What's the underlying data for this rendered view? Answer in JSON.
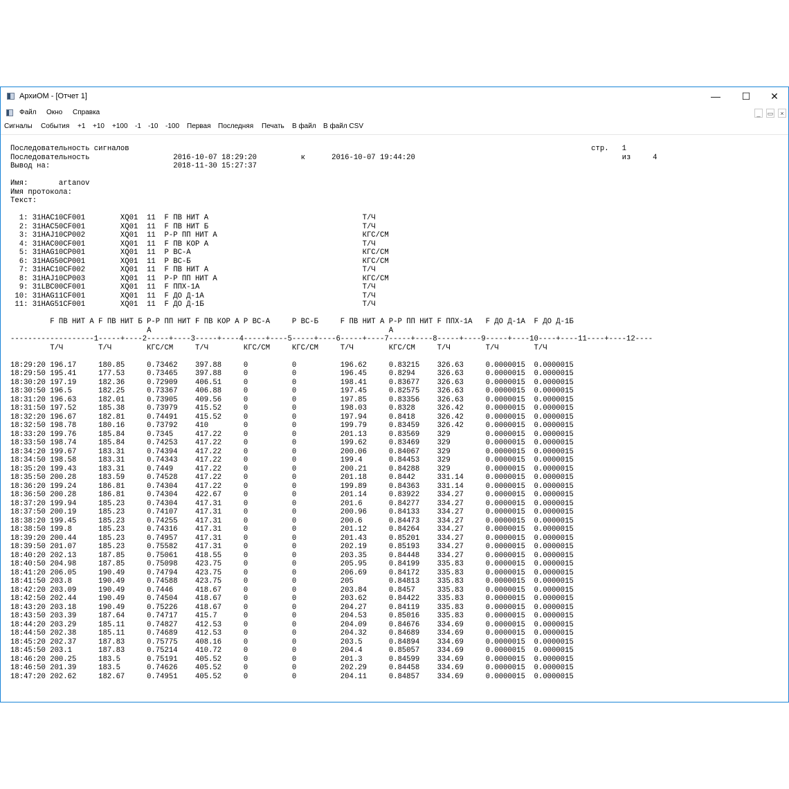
{
  "window": {
    "title": "АрхиОМ - [Отчет 1]",
    "controls": {
      "minimize": "—",
      "maximize": "☐",
      "close": "✕"
    },
    "icon": "app-window-icon"
  },
  "menu": {
    "items": [
      "Файл",
      "Окно",
      "Справка"
    ],
    "mdi_controls": {
      "minimize": "_",
      "restore": "▭",
      "close": "×"
    }
  },
  "toolbar": {
    "items": [
      "Сигналы",
      "События",
      "+1",
      "+10",
      "+100",
      "-1",
      "-10",
      "-100",
      "Первая",
      "Последняя",
      "Печать",
      "В файл",
      "В файл CSV"
    ]
  },
  "report": {
    "header": {
      "title": "Последовательность сигналов",
      "sequence_label": "Последовательность",
      "from": "2016-10-07 18:29:20",
      "to_word": "к",
      "to": "2016-10-07 19:44:20",
      "output_label": "Вывод на:",
      "output_time": "2018-11-30 15:27:37",
      "page_label": "стр.",
      "page": "1",
      "of_label": "из",
      "pages": "4",
      "name_label": "Имя:",
      "name": "artanov",
      "protocol_label": "Имя протокола:",
      "text_label": "Текст:"
    },
    "signals": [
      {
        "n": "1:",
        "code": "31HAC10CF001",
        "type": "XQ01",
        "num": "11",
        "desc": "F ПВ НИТ А",
        "unit": "Т/Ч"
      },
      {
        "n": "2:",
        "code": "31HAC50CF001",
        "type": "XQ01",
        "num": "11",
        "desc": "F ПВ НИТ Б",
        "unit": "Т/Ч"
      },
      {
        "n": "3:",
        "code": "31HAJ10CP002",
        "type": "XQ01",
        "num": "11",
        "desc": "Р-Р ПП НИТ А",
        "unit": "КГС/СМ"
      },
      {
        "n": "4:",
        "code": "31HAC00CF001",
        "type": "XQ01",
        "num": "11",
        "desc": "F ПВ КОР А",
        "unit": "Т/Ч"
      },
      {
        "n": "5:",
        "code": "31HAG10CP001",
        "type": "XQ01",
        "num": "11",
        "desc": "P ВС-А",
        "unit": "КГС/СМ"
      },
      {
        "n": "6:",
        "code": "31HAG50CP001",
        "type": "XQ01",
        "num": "11",
        "desc": "P ВС-Б",
        "unit": "КГС/СМ"
      },
      {
        "n": "7:",
        "code": "31HAC10CF002",
        "type": "XQ01",
        "num": "11",
        "desc": "F ПВ НИТ А",
        "unit": "Т/Ч"
      },
      {
        "n": "8:",
        "code": "31HAJ10CP003",
        "type": "XQ01",
        "num": "11",
        "desc": "Р-Р ПП НИТ А",
        "unit": "КГС/СМ"
      },
      {
        "n": "9:",
        "code": "31LBC00CF001",
        "type": "XQ01",
        "num": "11",
        "desc": "F ППХ-1А",
        "unit": "Т/Ч"
      },
      {
        "n": "10:",
        "code": "31HAG11CF001",
        "type": "XQ01",
        "num": "11",
        "desc": "F ДО Д-1А",
        "unit": "Т/Ч"
      },
      {
        "n": "11:",
        "code": "31HAG51CF001",
        "type": "XQ01",
        "num": "11",
        "desc": "F ДО Д-1Б",
        "unit": "Т/Ч"
      }
    ],
    "column_headers": [
      "F ПВ НИТ А",
      "F ПВ НИТ Б",
      "Р-Р ПП НИТ\nА",
      "F ПВ КОР А",
      "P ВС-А",
      "P ВС-Б",
      "F ПВ НИТ А",
      "Р-Р ПП НИТ\nА",
      "F ППХ-1А",
      "F ДО Д-1А",
      "F ДО Д-1Б"
    ],
    "column_numbers": [
      "1",
      "2",
      "3",
      "4",
      "5",
      "6",
      "7",
      "8",
      "9",
      "10",
      "11",
      "12"
    ],
    "column_units": [
      "Т/Ч",
      "Т/Ч",
      "КГС/СМ",
      "Т/Ч",
      "КГС/СМ",
      "КГС/СМ",
      "Т/Ч",
      "КГС/СМ",
      "Т/Ч",
      "Т/Ч",
      "Т/Ч"
    ],
    "rows": [
      [
        "18:29:20",
        "196.17",
        "180.85",
        "0.73462",
        "397.88",
        "0",
        "0",
        "196.62",
        "0.83215",
        "326.63",
        "0.0000015",
        "0.0000015"
      ],
      [
        "18:29:50",
        "195.41",
        "177.53",
        "0.73465",
        "397.88",
        "0",
        "0",
        "196.45",
        "0.8294",
        "326.63",
        "0.0000015",
        "0.0000015"
      ],
      [
        "18:30:20",
        "197.19",
        "182.36",
        "0.72909",
        "406.51",
        "0",
        "0",
        "198.41",
        "0.83677",
        "326.63",
        "0.0000015",
        "0.0000015"
      ],
      [
        "18:30:50",
        "196.5",
        "182.25",
        "0.73367",
        "406.88",
        "0",
        "0",
        "197.45",
        "0.82575",
        "326.63",
        "0.0000015",
        "0.0000015"
      ],
      [
        "18:31:20",
        "196.63",
        "182.01",
        "0.73905",
        "409.56",
        "0",
        "0",
        "197.85",
        "0.83356",
        "326.63",
        "0.0000015",
        "0.0000015"
      ],
      [
        "18:31:50",
        "197.52",
        "185.38",
        "0.73979",
        "415.52",
        "0",
        "0",
        "198.03",
        "0.8328",
        "326.42",
        "0.0000015",
        "0.0000015"
      ],
      [
        "18:32:20",
        "196.67",
        "182.81",
        "0.74491",
        "415.52",
        "0",
        "0",
        "197.94",
        "0.8418",
        "326.42",
        "0.0000015",
        "0.0000015"
      ],
      [
        "18:32:50",
        "198.78",
        "180.16",
        "0.73792",
        "410",
        "0",
        "0",
        "199.79",
        "0.83459",
        "326.42",
        "0.0000015",
        "0.0000015"
      ],
      [
        "18:33:20",
        "199.76",
        "185.84",
        "0.7345",
        "417.22",
        "0",
        "0",
        "201.13",
        "0.83569",
        "329",
        "0.0000015",
        "0.0000015"
      ],
      [
        "18:33:50",
        "198.74",
        "185.84",
        "0.74253",
        "417.22",
        "0",
        "0",
        "199.62",
        "0.83469",
        "329",
        "0.0000015",
        "0.0000015"
      ],
      [
        "18:34:20",
        "199.67",
        "183.31",
        "0.74394",
        "417.22",
        "0",
        "0",
        "200.06",
        "0.84067",
        "329",
        "0.0000015",
        "0.0000015"
      ],
      [
        "18:34:50",
        "198.58",
        "183.31",
        "0.74343",
        "417.22",
        "0",
        "0",
        "199.4",
        "0.84453",
        "329",
        "0.0000015",
        "0.0000015"
      ],
      [
        "18:35:20",
        "199.43",
        "183.31",
        "0.7449",
        "417.22",
        "0",
        "0",
        "200.21",
        "0.84288",
        "329",
        "0.0000015",
        "0.0000015"
      ],
      [
        "18:35:50",
        "200.28",
        "183.59",
        "0.74528",
        "417.22",
        "0",
        "0",
        "201.18",
        "0.8442",
        "331.14",
        "0.0000015",
        "0.0000015"
      ],
      [
        "18:36:20",
        "199.24",
        "186.81",
        "0.74304",
        "417.22",
        "0",
        "0",
        "199.89",
        "0.84363",
        "331.14",
        "0.0000015",
        "0.0000015"
      ],
      [
        "18:36:50",
        "200.28",
        "186.81",
        "0.74304",
        "422.67",
        "0",
        "0",
        "201.14",
        "0.83922",
        "334.27",
        "0.0000015",
        "0.0000015"
      ],
      [
        "18:37:20",
        "199.94",
        "185.23",
        "0.74304",
        "417.31",
        "0",
        "0",
        "201.6",
        "0.84277",
        "334.27",
        "0.0000015",
        "0.0000015"
      ],
      [
        "18:37:50",
        "200.19",
        "185.23",
        "0.74107",
        "417.31",
        "0",
        "0",
        "200.96",
        "0.84133",
        "334.27",
        "0.0000015",
        "0.0000015"
      ],
      [
        "18:38:20",
        "199.45",
        "185.23",
        "0.74255",
        "417.31",
        "0",
        "0",
        "200.6",
        "0.84473",
        "334.27",
        "0.0000015",
        "0.0000015"
      ],
      [
        "18:38:50",
        "199.8",
        "185.23",
        "0.74316",
        "417.31",
        "0",
        "0",
        "201.12",
        "0.84264",
        "334.27",
        "0.0000015",
        "0.0000015"
      ],
      [
        "18:39:20",
        "200.44",
        "185.23",
        "0.74957",
        "417.31",
        "0",
        "0",
        "201.43",
        "0.85201",
        "334.27",
        "0.0000015",
        "0.0000015"
      ],
      [
        "18:39:50",
        "201.07",
        "185.23",
        "0.75582",
        "417.31",
        "0",
        "0",
        "202.19",
        "0.85193",
        "334.27",
        "0.0000015",
        "0.0000015"
      ],
      [
        "18:40:20",
        "202.13",
        "187.85",
        "0.75061",
        "418.55",
        "0",
        "0",
        "203.35",
        "0.84448",
        "334.27",
        "0.0000015",
        "0.0000015"
      ],
      [
        "18:40:50",
        "204.98",
        "187.85",
        "0.75098",
        "423.75",
        "0",
        "0",
        "205.95",
        "0.84199",
        "335.83",
        "0.0000015",
        "0.0000015"
      ],
      [
        "18:41:20",
        "206.05",
        "190.49",
        "0.74794",
        "423.75",
        "0",
        "0",
        "206.69",
        "0.84172",
        "335.83",
        "0.0000015",
        "0.0000015"
      ],
      [
        "18:41:50",
        "203.8",
        "190.49",
        "0.74588",
        "423.75",
        "0",
        "0",
        "205",
        "0.84813",
        "335.83",
        "0.0000015",
        "0.0000015"
      ],
      [
        "18:42:20",
        "203.09",
        "190.49",
        "0.7446",
        "418.67",
        "0",
        "0",
        "203.84",
        "0.8457",
        "335.83",
        "0.0000015",
        "0.0000015"
      ],
      [
        "18:42:50",
        "202.44",
        "190.49",
        "0.74504",
        "418.67",
        "0",
        "0",
        "203.62",
        "0.84422",
        "335.83",
        "0.0000015",
        "0.0000015"
      ],
      [
        "18:43:20",
        "203.18",
        "190.49",
        "0.75226",
        "418.67",
        "0",
        "0",
        "204.27",
        "0.84119",
        "335.83",
        "0.0000015",
        "0.0000015"
      ],
      [
        "18:43:50",
        "203.39",
        "187.64",
        "0.74717",
        "415.7",
        "0",
        "0",
        "204.53",
        "0.85016",
        "335.83",
        "0.0000015",
        "0.0000015"
      ],
      [
        "18:44:20",
        "203.29",
        "185.11",
        "0.74827",
        "412.53",
        "0",
        "0",
        "204.09",
        "0.84676",
        "334.69",
        "0.0000015",
        "0.0000015"
      ],
      [
        "18:44:50",
        "202.38",
        "185.11",
        "0.74689",
        "412.53",
        "0",
        "0",
        "204.32",
        "0.84689",
        "334.69",
        "0.0000015",
        "0.0000015"
      ],
      [
        "18:45:20",
        "202.37",
        "187.83",
        "0.75775",
        "408.16",
        "0",
        "0",
        "203.5",
        "0.84894",
        "334.69",
        "0.0000015",
        "0.0000015"
      ],
      [
        "18:45:50",
        "203.1",
        "187.83",
        "0.75214",
        "410.72",
        "0",
        "0",
        "204.4",
        "0.85057",
        "334.69",
        "0.0000015",
        "0.0000015"
      ],
      [
        "18:46:20",
        "200.25",
        "183.5",
        "0.75191",
        "405.52",
        "0",
        "0",
        "201.3",
        "0.84599",
        "334.69",
        "0.0000015",
        "0.0000015"
      ],
      [
        "18:46:50",
        "201.39",
        "183.5",
        "0.74626",
        "405.52",
        "0",
        "0",
        "202.29",
        "0.84458",
        "334.69",
        "0.0000015",
        "0.0000015"
      ],
      [
        "18:47:20",
        "202.62",
        "182.67",
        "0.74951",
        "405.52",
        "0",
        "0",
        "204.11",
        "0.84857",
        "334.69",
        "0.0000015",
        "0.0000015"
      ]
    ]
  },
  "colors": {
    "window_border": "#1883d7",
    "text": "#000000",
    "background": "#ffffff"
  }
}
